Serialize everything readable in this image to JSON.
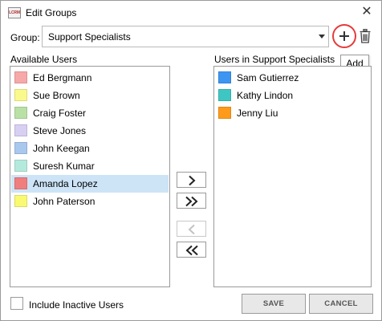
{
  "window": {
    "title": "Edit Groups",
    "icon_text": "LCRM",
    "close_glyph": "✕"
  },
  "group": {
    "label": "Group:",
    "selected": "Support Specialists"
  },
  "tooltip": {
    "add": "Add"
  },
  "available": {
    "label": "Available Users",
    "items": [
      {
        "name": "Ed Bergmann",
        "color": "#f7a8a8"
      },
      {
        "name": "Sue Brown",
        "color": "#fafa8c"
      },
      {
        "name": "Craig Foster",
        "color": "#b9e1a6"
      },
      {
        "name": "Steve Jones",
        "color": "#d8d0f2"
      },
      {
        "name": "John Keegan",
        "color": "#a8c8ee"
      },
      {
        "name": "Suresh Kumar",
        "color": "#b4eadc"
      },
      {
        "name": "Amanda Lopez",
        "color": "#f07e7e"
      },
      {
        "name": "John Paterson",
        "color": "#fafa72"
      }
    ],
    "selected_index": 6
  },
  "members": {
    "label": "Users in Support Specialists",
    "items": [
      {
        "name": "Sam Gutierrez",
        "color": "#3d95f2"
      },
      {
        "name": "Kathy Lindon",
        "color": "#3ec7c2"
      },
      {
        "name": "Jenny Liu",
        "color": "#ff9a1a"
      }
    ]
  },
  "include_inactive": {
    "label": "Include Inactive Users",
    "checked": false
  },
  "buttons": {
    "save": "SAVE",
    "cancel": "CANCEL"
  },
  "colors": {
    "highlight_circle": "#e53b3b",
    "selected_row": "#cde4f7"
  }
}
